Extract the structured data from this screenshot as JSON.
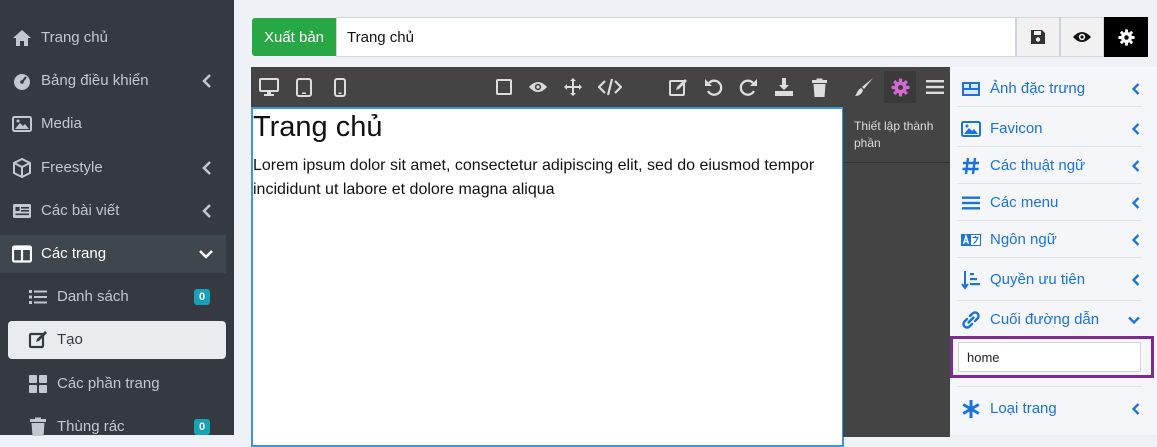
{
  "sidebar": {
    "items": [
      {
        "label": "Trang chủ",
        "icon": "home-icon"
      },
      {
        "label": "Bảng điều khiển",
        "icon": "dashboard-icon"
      },
      {
        "label": "Media",
        "icon": "image-icon"
      },
      {
        "label": "Freestyle",
        "icon": "cube-icon"
      },
      {
        "label": "Các bài viết",
        "icon": "newspaper-icon"
      },
      {
        "label": "Các trang",
        "icon": "columns-icon"
      }
    ],
    "subitems": [
      {
        "label": "Danh sách",
        "icon": "list-icon",
        "badge": "0"
      },
      {
        "label": "Tạo",
        "icon": "edit-icon"
      },
      {
        "label": "Các phần trang",
        "icon": "grid-icon"
      },
      {
        "label": "Thùng rác",
        "icon": "trash-icon",
        "badge": "0"
      }
    ]
  },
  "topbar": {
    "publish_label": "Xuất bản",
    "title_value": "Trang chủ"
  },
  "canvas": {
    "heading": "Trang chủ",
    "paragraph": "Lorem ipsum dolor sit amet, consectetur adipiscing elit, sed do eiusmod tempor incididunt ut labore et dolore magna aliqua"
  },
  "panel": {
    "title": "Thiết lập thành phần"
  },
  "accordion": {
    "items": [
      {
        "label": "Ảnh đặc trưng",
        "icon": "featured-image-icon"
      },
      {
        "label": "Favicon",
        "icon": "image-icon"
      },
      {
        "label": "Các thuật ngữ",
        "icon": "hashtag-icon"
      },
      {
        "label": "Các menu",
        "icon": "bars-icon"
      },
      {
        "label": "Ngôn ngữ",
        "icon": "language-icon"
      },
      {
        "label": "Quyền ưu tiên",
        "icon": "sort-icon"
      },
      {
        "label": "Cuối đường dẫn",
        "icon": "link-icon"
      },
      {
        "label": "Loại trang",
        "icon": "asterisk-icon"
      }
    ],
    "slug_value": "home"
  },
  "colors": {
    "sidebar_bg": "#343a40",
    "publish_green": "#28a745",
    "accent_blue": "#1a73d9",
    "badge_teal": "#17a2b8",
    "highlight_purple": "#7b2d8e",
    "gear_pink": "#d36ad0"
  }
}
